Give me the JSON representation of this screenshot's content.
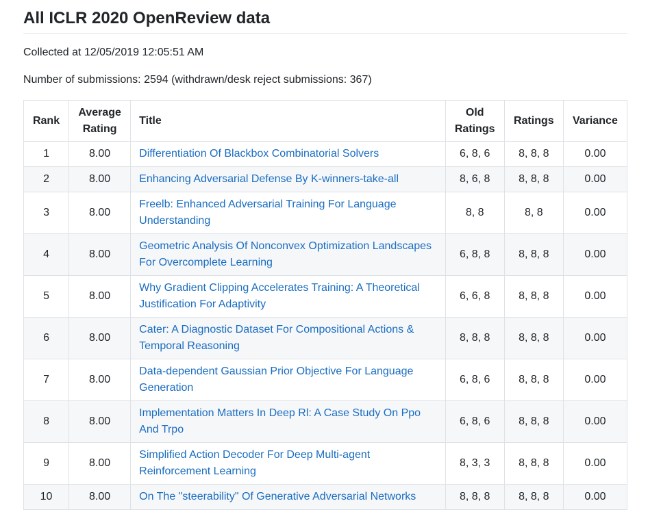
{
  "page": {
    "title": "All ICLR 2020 OpenReview data",
    "collected": "Collected at 12/05/2019 12:05:51 AM",
    "submissions": "Number of submissions: 2594 (withdrawn/desk reject submissions: 367)"
  },
  "table": {
    "headers": {
      "rank": "Rank",
      "avg_line1": "Average",
      "avg_line2": "Rating",
      "title": "Title",
      "old_line1": "Old",
      "old_line2": "Ratings",
      "ratings": "Ratings",
      "variance": "Variance"
    },
    "rows": [
      {
        "rank": "1",
        "avg": "8.00",
        "title": "Differentiation Of Blackbox Combinatorial Solvers",
        "old": "6, 8, 6",
        "ratings": "8, 8, 8",
        "variance": "0.00"
      },
      {
        "rank": "2",
        "avg": "8.00",
        "title": "Enhancing Adversarial Defense By K-winners-take-all",
        "old": "8, 6, 8",
        "ratings": "8, 8, 8",
        "variance": "0.00"
      },
      {
        "rank": "3",
        "avg": "8.00",
        "title": "Freelb: Enhanced Adversarial Training For Language Understanding",
        "old": "8, 8",
        "ratings": "8, 8",
        "variance": "0.00"
      },
      {
        "rank": "4",
        "avg": "8.00",
        "title": "Geometric Analysis Of Nonconvex Optimization Landscapes For Overcomplete Learning",
        "old": "6, 8, 8",
        "ratings": "8, 8, 8",
        "variance": "0.00"
      },
      {
        "rank": "5",
        "avg": "8.00",
        "title": "Why Gradient Clipping Accelerates Training: A Theoretical Justification For Adaptivity",
        "old": "6, 6, 8",
        "ratings": "8, 8, 8",
        "variance": "0.00"
      },
      {
        "rank": "6",
        "avg": "8.00",
        "title": "Cater: A Diagnostic Dataset For Compositional Actions & Temporal Reasoning",
        "old": "8, 8, 8",
        "ratings": "8, 8, 8",
        "variance": "0.00"
      },
      {
        "rank": "7",
        "avg": "8.00",
        "title": "Data-dependent Gaussian Prior Objective For Language Generation",
        "old": "6, 8, 6",
        "ratings": "8, 8, 8",
        "variance": "0.00"
      },
      {
        "rank": "8",
        "avg": "8.00",
        "title": "Implementation Matters In Deep Rl: A Case Study On Ppo And Trpo",
        "old": "6, 8, 6",
        "ratings": "8, 8, 8",
        "variance": "0.00"
      },
      {
        "rank": "9",
        "avg": "8.00",
        "title": "Simplified Action Decoder For Deep Multi-agent Reinforcement Learning",
        "old": "8, 3, 3",
        "ratings": "8, 8, 8",
        "variance": "0.00"
      },
      {
        "rank": "10",
        "avg": "8.00",
        "title": "On The \"steerability\" Of Generative Adversarial Networks",
        "old": "8, 8, 8",
        "ratings": "8, 8, 8",
        "variance": "0.00"
      }
    ]
  }
}
